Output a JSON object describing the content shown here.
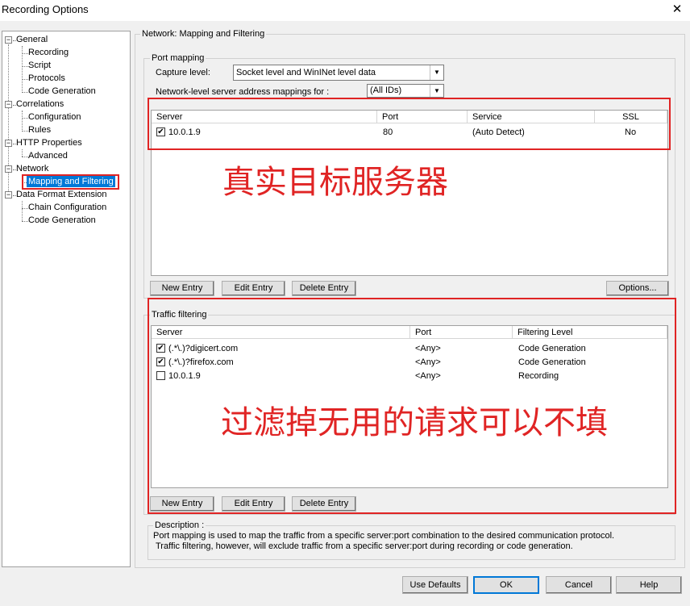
{
  "window": {
    "title": "Recording Options",
    "close_glyph": "✕"
  },
  "tree": {
    "items": [
      {
        "label": "General",
        "level": 0,
        "expander": "−"
      },
      {
        "label": "Recording",
        "level": 1
      },
      {
        "label": "Script",
        "level": 1
      },
      {
        "label": "Protocols",
        "level": 1
      },
      {
        "label": "Code Generation",
        "level": 1
      },
      {
        "label": "Correlations",
        "level": 0,
        "expander": "−"
      },
      {
        "label": "Configuration",
        "level": 1
      },
      {
        "label": "Rules",
        "level": 1
      },
      {
        "label": "HTTP Properties",
        "level": 0,
        "expander": "−"
      },
      {
        "label": "Advanced",
        "level": 1
      },
      {
        "label": "Network",
        "level": 0,
        "expander": "−"
      },
      {
        "label": "Mapping and Filtering",
        "level": 1,
        "selected": true
      },
      {
        "label": "Data Format Extension",
        "level": 0,
        "expander": "−"
      },
      {
        "label": "Chain Configuration",
        "level": 1
      },
      {
        "label": "Code Generation",
        "level": 1
      }
    ]
  },
  "panel": {
    "title": "Network: Mapping and Filtering"
  },
  "port_mapping": {
    "title": "Port mapping",
    "capture_label": "Capture level:",
    "capture_value": "Socket level and WinINet level data",
    "address_label": "Network-level server address mappings for :",
    "address_value": "(All IDs)",
    "columns": [
      "Server",
      "Port",
      "Service",
      "SSL"
    ],
    "rows": [
      {
        "checked": true,
        "server": "10.0.1.9",
        "port": "80",
        "service": "(Auto Detect)",
        "ssl": "No"
      }
    ],
    "buttons": {
      "new": "New Entry",
      "edit": "Edit Entry",
      "delete": "Delete Entry",
      "options": "Options..."
    }
  },
  "traffic_filtering": {
    "title": "Traffic filtering",
    "columns": [
      "Server",
      "Port",
      "Filtering Level"
    ],
    "rows": [
      {
        "checked": true,
        "server": "(.*\\.)?digicert.com",
        "port": "<Any>",
        "level": "Code Generation"
      },
      {
        "checked": true,
        "server": "(.*\\.)?firefox.com",
        "port": "<Any>",
        "level": "Code Generation"
      },
      {
        "checked": false,
        "server": "10.0.1.9",
        "port": "<Any>",
        "level": "Recording"
      }
    ],
    "buttons": {
      "new": "New Entry",
      "edit": "Edit Entry",
      "delete": "Delete Entry"
    }
  },
  "description": {
    "title": "Description :",
    "line1": "Port mapping is used to map the traffic from a specific server:port combination to the desired communication protocol.",
    "line2": "Traffic filtering, however, will exclude traffic from a specific server:port during recording or code generation."
  },
  "annotations": {
    "top": "真实目标服务器",
    "bottom": "过滤掉无用的请求可以不填",
    "color": "#e02424"
  },
  "footer": {
    "use_defaults": "Use Defaults",
    "ok": "OK",
    "cancel": "Cancel",
    "help": "Help"
  },
  "check_glyph": "✔"
}
